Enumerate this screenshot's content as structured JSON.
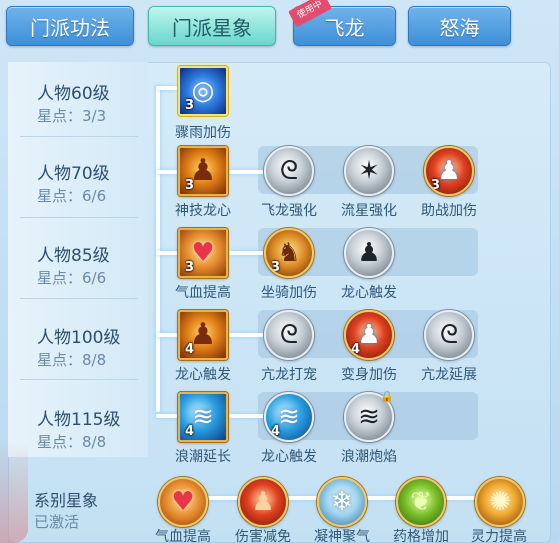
{
  "tabs": [
    {
      "label": "门派功法"
    },
    {
      "label": "门派星象"
    },
    {
      "label": "飞龙",
      "badge": "使用中"
    },
    {
      "label": "怒海"
    }
  ],
  "rows": [
    {
      "level": "人物60级",
      "stars": "星点：3/3"
    },
    {
      "level": "人物70级",
      "stars": "星点：6/6"
    },
    {
      "level": "人物85级",
      "stars": "星点：6/6"
    },
    {
      "level": "人物100级",
      "stars": "星点：8/8"
    },
    {
      "level": "人物115级",
      "stars": "星点：8/8"
    }
  ],
  "skills": {
    "r1": [
      {
        "name": "骤雨加伤",
        "count": "3",
        "icon": "swirl-icon"
      }
    ],
    "r2": [
      {
        "name": "神技龙心",
        "count": "3",
        "icon": "fire-warrior-icon"
      },
      {
        "name": "飞龙强化",
        "count": "",
        "icon": "dragon-icon"
      },
      {
        "name": "流星强化",
        "count": "",
        "icon": "meteor-icon"
      },
      {
        "name": "助战加伤",
        "count": "3",
        "icon": "swirl-body-icon"
      }
    ],
    "r3": [
      {
        "name": "气血提高",
        "count": "3",
        "icon": "heart-icon"
      },
      {
        "name": "坐骑加伤",
        "count": "3",
        "icon": "mount-icon"
      },
      {
        "name": "龙心触发",
        "count": "",
        "icon": "person-icon"
      }
    ],
    "r4": [
      {
        "name": "龙心触发",
        "count": "4",
        "icon": "fire-warrior-icon"
      },
      {
        "name": "亢龙打宠",
        "count": "",
        "icon": "dragon-icon"
      },
      {
        "name": "变身加伤",
        "count": "4",
        "icon": "swirl-body-icon"
      },
      {
        "name": "亢龙延展",
        "count": "",
        "icon": "dragon-icon"
      }
    ],
    "r5": [
      {
        "name": "浪潮延长",
        "count": "4",
        "icon": "wave-icon"
      },
      {
        "name": "龙心触发",
        "count": "4",
        "icon": "wave-icon"
      },
      {
        "name": "浪潮炮焰",
        "count": "",
        "icon": "wave-lock-icon"
      }
    ]
  },
  "system": {
    "title": "系别星象",
    "status": "已激活",
    "items": [
      {
        "name": "气血提高",
        "icon": "heart-icon"
      },
      {
        "name": "伤害减免",
        "icon": "warrior-icon"
      },
      {
        "name": "凝神聚气",
        "icon": "frost-icon"
      },
      {
        "name": "药格增加",
        "icon": "leaf-icon"
      },
      {
        "name": "灵力提高",
        "icon": "sun-icon"
      }
    ]
  },
  "colors": {
    "accent": "#3f8fd8",
    "active_tab": "#68d7cc",
    "panel": "#c3e0f3",
    "count_text": "#ffffff"
  }
}
